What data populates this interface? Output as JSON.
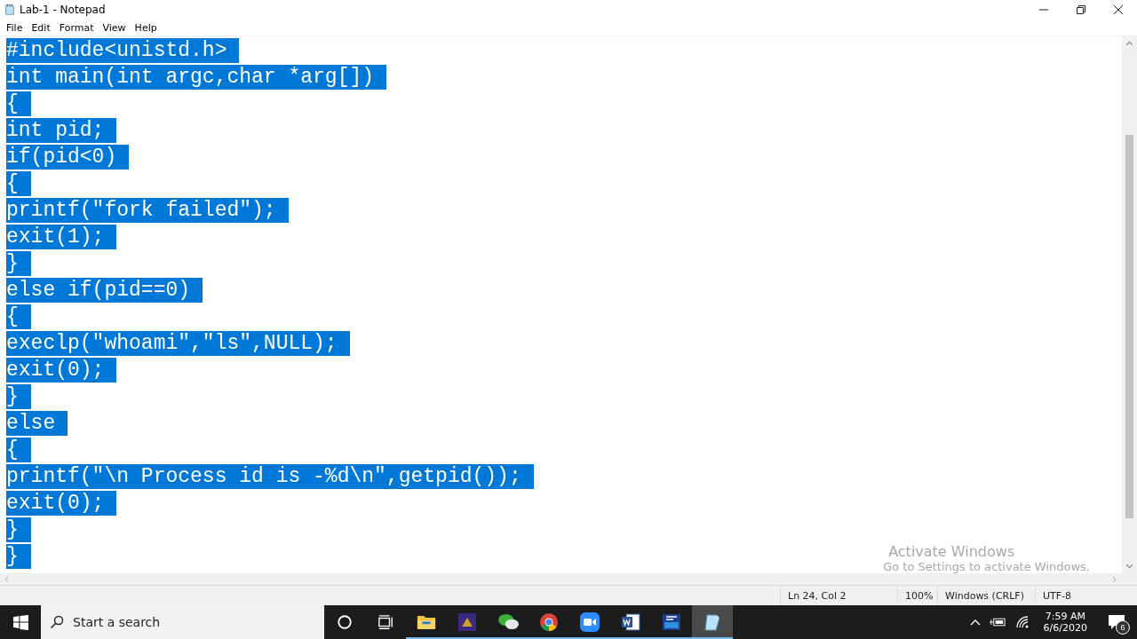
{
  "window": {
    "title": "Lab-1 - Notepad"
  },
  "menu": [
    "File",
    "Edit",
    "Format",
    "View",
    "Help"
  ],
  "editor": {
    "lines": [
      {
        "text": "#include<unistd.h>",
        "selected": true
      },
      {
        "text": "int main(int argc,char *arg[])",
        "selected": true
      },
      {
        "text": "{",
        "selected": true
      },
      {
        "text": "int pid;",
        "selected": true
      },
      {
        "text": "if(pid<0)",
        "selected": true
      },
      {
        "text": "{",
        "selected": true
      },
      {
        "text": "printf(\"fork failed\");",
        "selected": true
      },
      {
        "text": "exit(1);",
        "selected": true
      },
      {
        "text": "}",
        "selected": true
      },
      {
        "text": "else if(pid==0)",
        "selected": true
      },
      {
        "text": "{",
        "selected": true
      },
      {
        "text": "execlp(\"whoami\",\"ls\",NULL);",
        "selected": true
      },
      {
        "text": "exit(0);",
        "selected": true
      },
      {
        "text": "}",
        "selected": true
      },
      {
        "text": "else",
        "selected": true
      },
      {
        "text": "{",
        "selected": true
      },
      {
        "text": "printf(\"\\n Process id is -%d\\n\",getpid());",
        "selected": true
      },
      {
        "text": "exit(0);",
        "selected": true
      },
      {
        "text": "}",
        "selected": true
      },
      {
        "text": "}",
        "selected": true
      }
    ]
  },
  "activation_notice": {
    "title": "Activate Windows",
    "message": "Go to Settings to activate Windows."
  },
  "status_bar": {
    "position": "Ln 24, Col 2",
    "zoom": "100%",
    "line_ending": "Windows (CRLF)",
    "encoding": "UTF-8"
  },
  "taskbar": {
    "search_placeholder": "Start a search",
    "apps": [
      {
        "kind": "cortana",
        "running": false,
        "active": false
      },
      {
        "kind": "taskview",
        "running": false,
        "active": false
      },
      {
        "kind": "folder",
        "running": true,
        "active": false
      },
      {
        "kind": "jpx",
        "running": true,
        "active": false
      },
      {
        "kind": "chat",
        "running": true,
        "active": false
      },
      {
        "kind": "browser",
        "running": true,
        "active": false
      },
      {
        "kind": "camera",
        "running": true,
        "active": false
      },
      {
        "kind": "word",
        "running": true,
        "active": false
      },
      {
        "kind": "dev",
        "running": true,
        "active": false
      },
      {
        "kind": "notepad",
        "running": true,
        "active": true
      }
    ],
    "time": "7:59 AM",
    "date": "6/6/2020",
    "notifications": "6"
  }
}
